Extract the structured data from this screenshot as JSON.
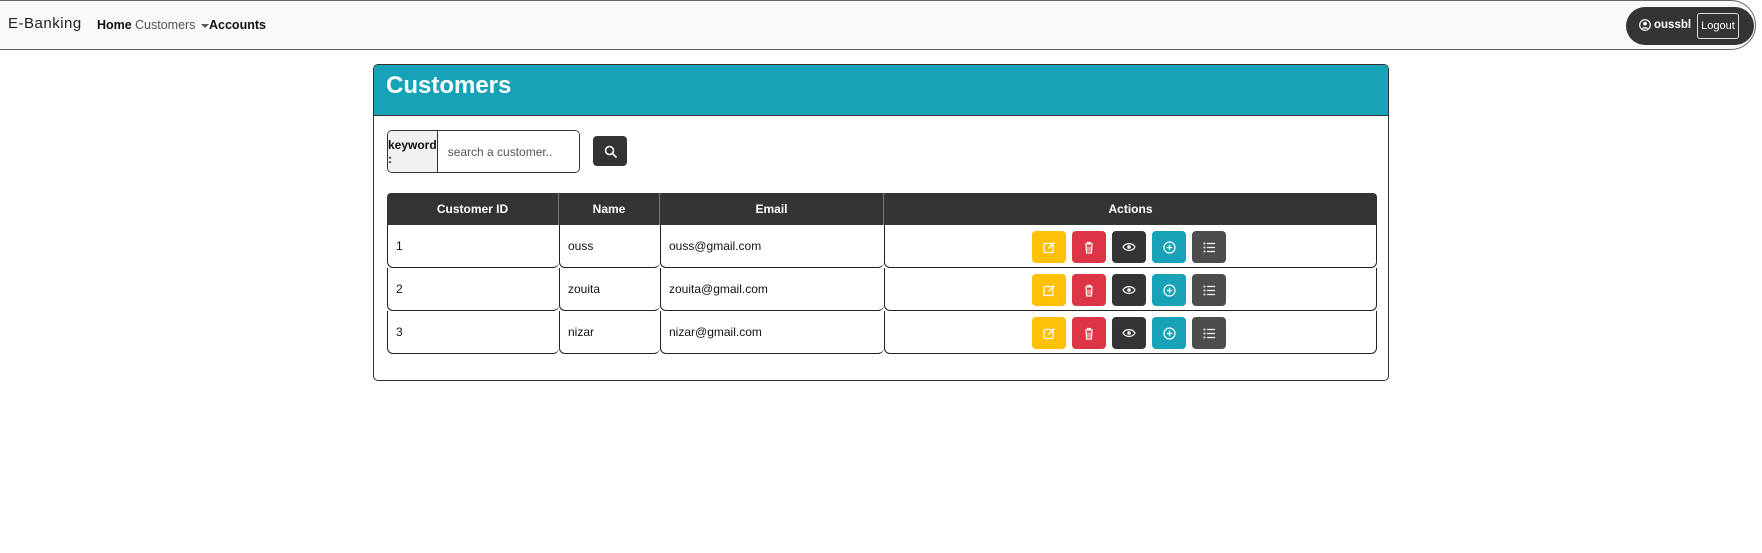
{
  "navbar": {
    "brand": "E-Banking",
    "home_label": "Home",
    "customers_label": "Customers",
    "accounts_label": "Accounts",
    "user_name": "oussbl",
    "logout_label": "Logout"
  },
  "card": {
    "title": "Customers",
    "search": {
      "label": "keyword :",
      "placeholder": "search a customer..",
      "value": ""
    }
  },
  "table": {
    "headers": [
      "Customer ID",
      "Name",
      "Email",
      "Actions"
    ],
    "rows": [
      {
        "id": "1",
        "name": "ouss",
        "email": "ouss@gmail.com"
      },
      {
        "id": "2",
        "name": "zouita",
        "email": "zouita@gmail.com"
      },
      {
        "id": "3",
        "name": "nizar",
        "email": "nizar@gmail.com"
      }
    ],
    "action_icons": [
      "edit-icon",
      "trash-icon",
      "eye-icon",
      "plus-circle-icon",
      "list-icon"
    ]
  },
  "colors": {
    "header_bg": "#17a2b8",
    "dark": "#343434",
    "warning": "#ffc107",
    "danger": "#dc3545",
    "info": "#17a2b8",
    "secondary": "#4d4d4d"
  }
}
